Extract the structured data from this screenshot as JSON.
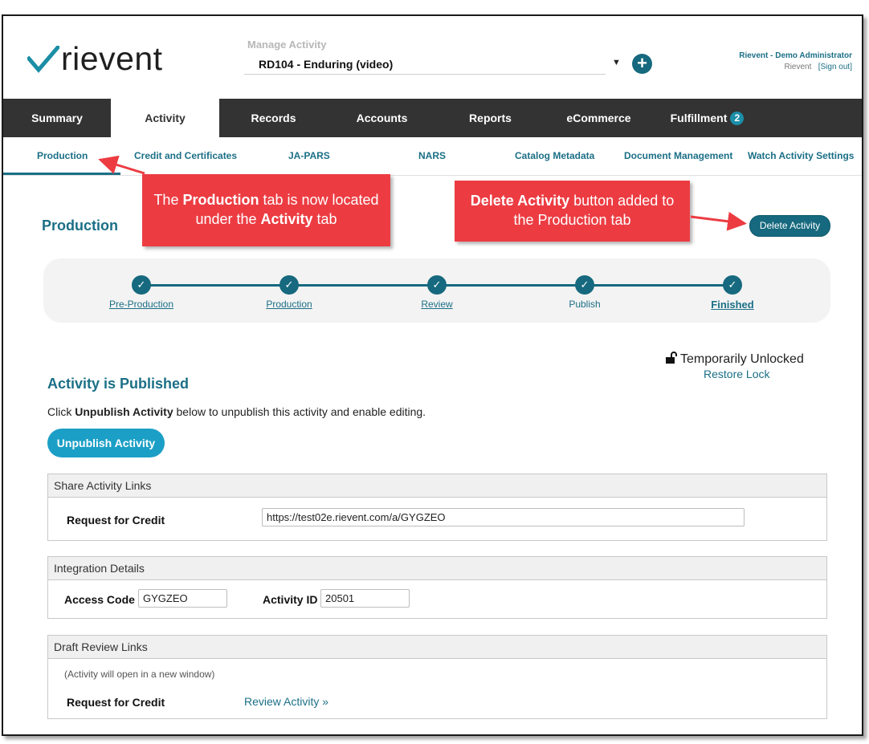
{
  "header": {
    "logo_text": "rievent",
    "manage_label": "Manage Activity",
    "activity_selected": "RD104 - Enduring (video)",
    "user_name": "Rievent - Demo Administrator",
    "user_org": "Rievent",
    "sign_out": "[Sign out]"
  },
  "main_nav": {
    "tabs": [
      "Summary",
      "Activity",
      "Records",
      "Accounts",
      "Reports",
      "eCommerce",
      "Fulfillment"
    ],
    "active": "Activity",
    "fulfillment_badge": "2"
  },
  "sub_nav": {
    "tabs": [
      "Production",
      "Credit and Certificates",
      "JA-PARS",
      "NARS",
      "Catalog Metadata",
      "Document Management",
      "Watch Activity Settings"
    ],
    "active": "Production"
  },
  "production": {
    "title": "Production",
    "delete_button": "Delete Activity"
  },
  "callouts": {
    "left": {
      "pre": "The ",
      "b1": "Production",
      "mid": " tab is now located under the ",
      "b2": "Activity",
      "post": " tab"
    },
    "right": {
      "b1": "Delete Activity",
      "rest": " button added to the Production tab"
    }
  },
  "progress": {
    "steps": [
      "Pre-Production",
      "Production",
      "Review",
      "Publish",
      "Finished"
    ]
  },
  "lock": {
    "status": "Temporarily Unlocked",
    "restore": "Restore Lock"
  },
  "published": {
    "title": "Activity is Published",
    "desc_pre": "Click ",
    "desc_bold": "Unpublish Activity",
    "desc_post": " below to unpublish this activity and enable editing.",
    "button": "Unpublish Activity"
  },
  "share_links": {
    "heading": "Share Activity Links",
    "label": "Request for Credit",
    "url": "https://test02e.rievent.com/a/GYGZEO"
  },
  "integration": {
    "heading": "Integration Details",
    "access_code_label": "Access Code",
    "access_code": "GYGZEO",
    "activity_id_label": "Activity ID",
    "activity_id": "20501"
  },
  "draft_review": {
    "heading": "Draft Review Links",
    "note": "(Activity will open in a new window)",
    "label": "Request for Credit",
    "link": "Review Activity »"
  },
  "colors": {
    "teal": "#16697e",
    "callout": "#ec3c42",
    "nav": "#333333",
    "button": "#1b9fc6"
  }
}
